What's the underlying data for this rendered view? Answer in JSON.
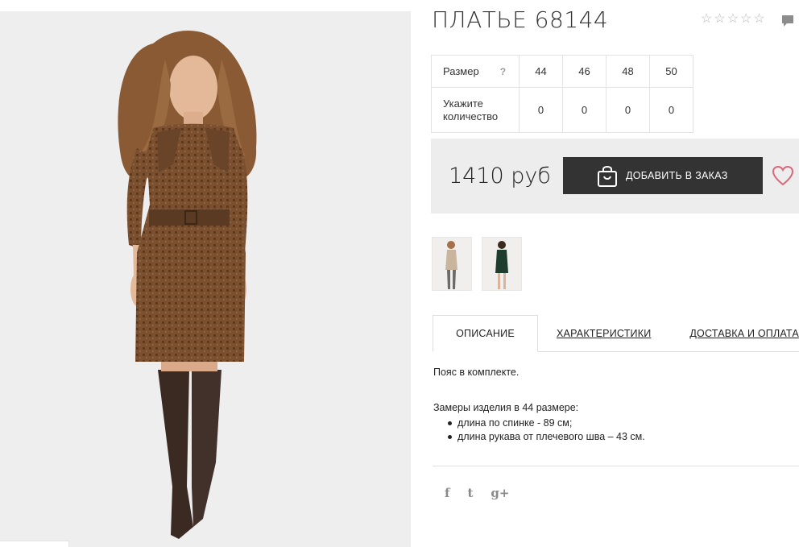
{
  "product": {
    "title": "ПЛАТЬЕ 68144",
    "rating_stars": [
      "☆",
      "☆",
      "☆",
      "☆",
      "☆"
    ],
    "price": "1410 руб",
    "add_button_label": "ДОБАВИТЬ В ЗАКАЗ"
  },
  "sizes": {
    "size_label": "Размер",
    "help_mark": "?",
    "quantity_label": "Укажите количество",
    "values": [
      "44",
      "46",
      "48",
      "50"
    ],
    "quantities": [
      "0",
      "0",
      "0",
      "0"
    ]
  },
  "tabs": [
    {
      "label": "ОПИСАНИЕ"
    },
    {
      "label": "ХАРАКТЕРИСТИКИ"
    },
    {
      "label": "ДОСТАВКА И ОПЛАТА"
    }
  ],
  "description": {
    "line1": "Пояс в комплекте.",
    "line2": "Замеры изделия в 44 размере:",
    "bullets": [
      "длина по спинке - 89 см;",
      "длина рукава от плечевого шва – 43 см."
    ]
  },
  "social": {
    "facebook": "f",
    "twitter": "t",
    "googleplus": "g+"
  },
  "colors": {
    "button_bg": "#333333",
    "price_box_bg": "#ededed",
    "heart": "#d9677a",
    "dress": "#7a5030",
    "boots": "#3a2a22",
    "hair": "#8a5a34"
  },
  "icons": {
    "add_button": "shopping-bag-icon",
    "wishlist": "heart-icon",
    "comments": "comment-icon"
  }
}
